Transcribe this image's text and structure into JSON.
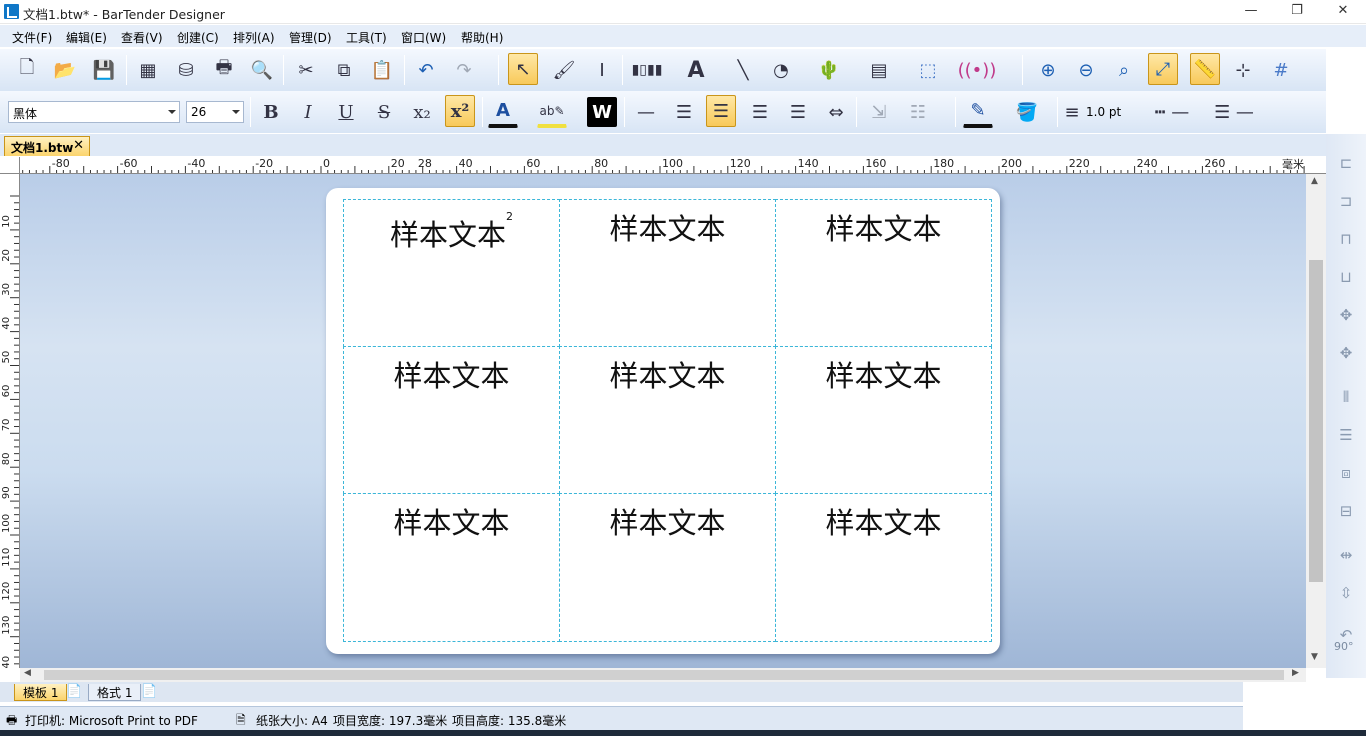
{
  "window": {
    "title": "文档1.btw* - BarTender Designer",
    "minimize": "—",
    "restore": "❐",
    "close": "✕"
  },
  "menu": [
    "文件(F)",
    "编辑(E)",
    "查看(V)",
    "创建(C)",
    "排列(A)",
    "管理(D)",
    "工具(T)",
    "窗口(W)",
    "帮助(H)"
  ],
  "formatting": {
    "font_name": "黑体",
    "font_size": "26",
    "line_width": "1.0 pt",
    "bold": "B",
    "italic": "I",
    "underline": "U",
    "strike": "S",
    "subscript": "x₂",
    "superscript": "x²",
    "font_color": "A",
    "word_icon": "W"
  },
  "document_tab": {
    "name": "文档1.btw"
  },
  "ruler": {
    "unit": "毫米",
    "h_labels": [
      "-80",
      "-60",
      "-40",
      "-20",
      "0",
      "20",
      "40",
      "60",
      "80",
      "100",
      "120",
      "140",
      "160",
      "180",
      "200",
      "220",
      "240",
      "260",
      "28"
    ],
    "v_labels": [
      "10",
      "20",
      "30",
      "40",
      "50",
      "60",
      "70",
      "80",
      "90",
      "100",
      "110",
      "120",
      "130",
      "40"
    ]
  },
  "label": {
    "cells": [
      {
        "text": "样本文本",
        "sup": "2"
      },
      {
        "text": "样本文本",
        "sup": ""
      },
      {
        "text": "样本文本",
        "sup": ""
      },
      {
        "text": "样本文本",
        "sup": ""
      },
      {
        "text": "样本文本",
        "sup": ""
      },
      {
        "text": "样本文本",
        "sup": ""
      },
      {
        "text": "样本文本",
        "sup": ""
      },
      {
        "text": "样本文本",
        "sup": ""
      },
      {
        "text": "样本文本",
        "sup": ""
      }
    ]
  },
  "sheet_tabs": [
    {
      "label": "模板 1",
      "active": true
    },
    {
      "label": "格式 1",
      "active": false
    }
  ],
  "right_panel": {
    "rotate_label": "90°"
  },
  "status": {
    "printer": "打印机: Microsoft Print to PDF",
    "paper": "纸张大小: A4",
    "width": "项目宽度: 197.3毫米",
    "height": "项目高度: 135.8毫米"
  },
  "colors": {
    "accent_highlight": "#f8c95a",
    "guide_line": "#3cb6d8",
    "canvas_bg": "#c8d9ee"
  }
}
